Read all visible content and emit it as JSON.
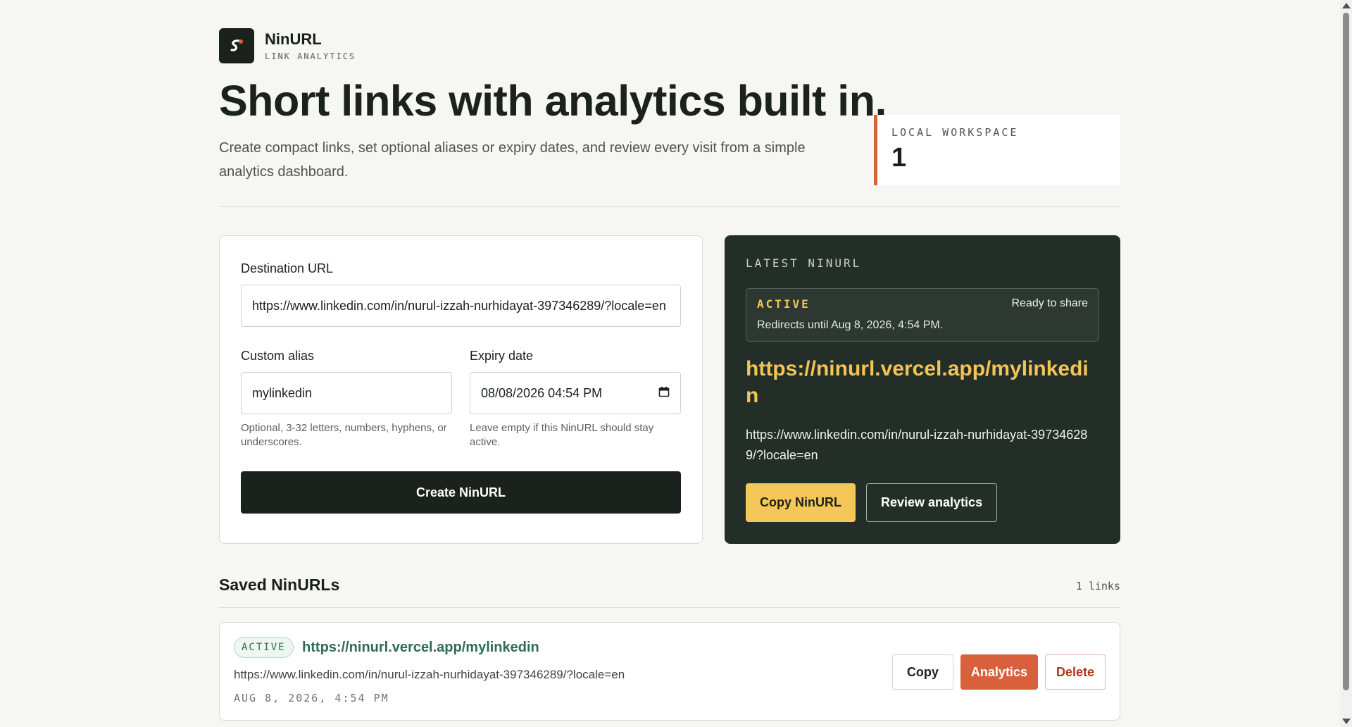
{
  "brand": {
    "name": "NinURL",
    "subtitle": "LINK ANALYTICS",
    "logo_icon": "link-logo-icon"
  },
  "hero": {
    "title": "Short links with analytics built in.",
    "lede": "Create compact links, set optional aliases or expiry dates, and review every visit from a simple analytics dashboard."
  },
  "workspace": {
    "label": "LOCAL WORKSPACE",
    "value": "1"
  },
  "form": {
    "destination_label": "Destination URL",
    "destination_value": "https://www.linkedin.com/in/nurul-izzah-nurhidayat-397346289/?locale=en",
    "alias_label": "Custom alias",
    "alias_value": "mylinkedin",
    "alias_hint": "Optional, 3-32 letters, numbers, hyphens, or underscores.",
    "expiry_label": "Expiry date",
    "expiry_value": "08/08/2026 04:54 PM",
    "expiry_hint": "Leave empty if this NinURL should stay active.",
    "create_label": "Create NinURL"
  },
  "latest": {
    "label": "LATEST NINURL",
    "status": "ACTIVE",
    "ready": "Ready to share",
    "until": "Redirects until Aug 8, 2026, 4:54 PM.",
    "short_url": "https://ninurl.vercel.app/mylinkedin",
    "long_url": "https://www.linkedin.com/in/nurul-izzah-nurhidayat-397346289/?locale=en",
    "copy_label": "Copy NinURL",
    "review_label": "Review analytics"
  },
  "saved": {
    "title": "Saved NinURLs",
    "count": "1 links",
    "items": [
      {
        "status": "ACTIVE",
        "short_url": "https://ninurl.vercel.app/mylinkedin",
        "long_url": "https://www.linkedin.com/in/nurul-izzah-nurhidayat-397346289/?locale=en",
        "date": "AUG 8, 2026, 4:54 PM",
        "copy_label": "Copy",
        "analytics_label": "Analytics",
        "delete_label": "Delete"
      }
    ]
  },
  "colors": {
    "accent": "#d8613c",
    "dark": "#1b211d",
    "yellow": "#f5c658",
    "green": "#2e6b58"
  }
}
